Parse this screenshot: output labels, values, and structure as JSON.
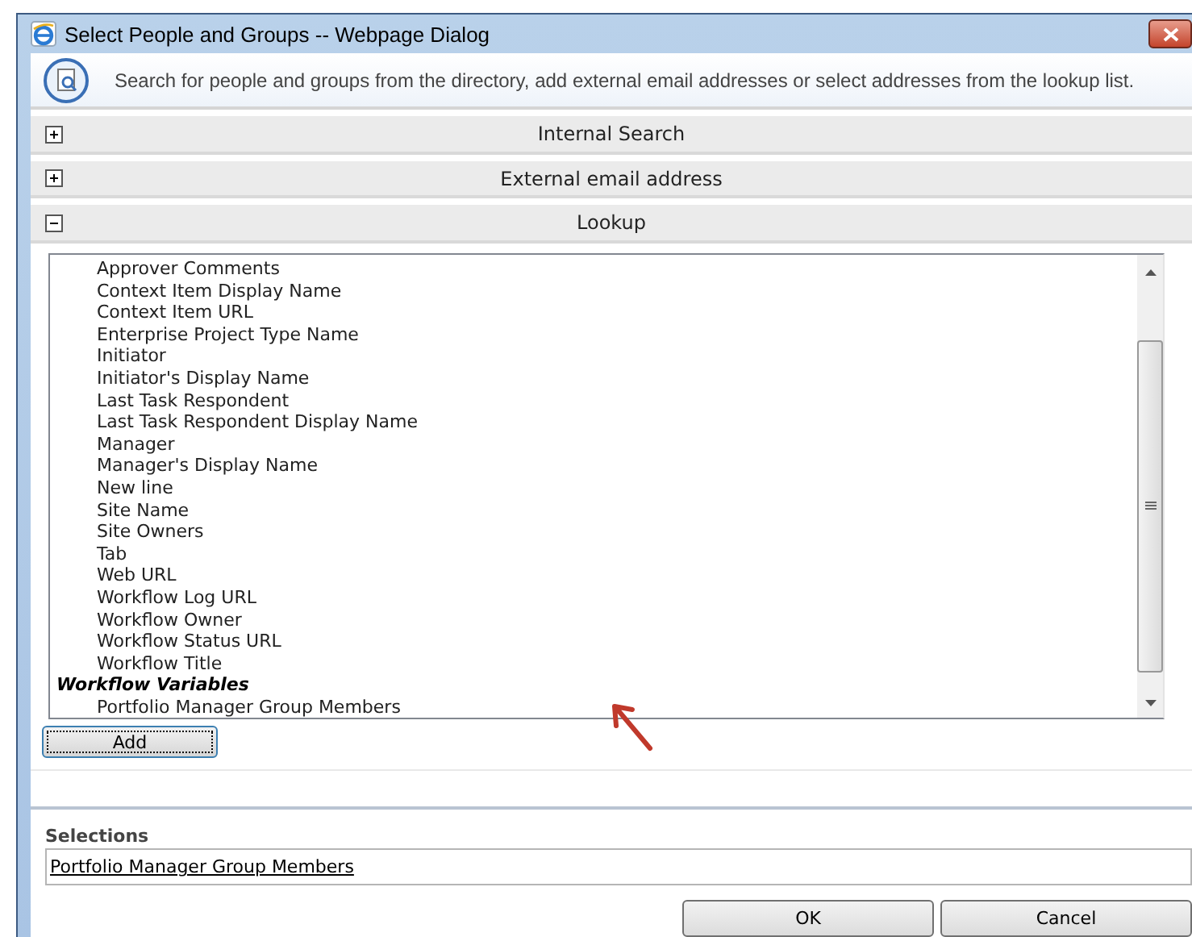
{
  "window": {
    "title": "Select People and Groups -- Webpage Dialog"
  },
  "header": {
    "description": "Search for people and groups from the directory, add external email addresses or select addresses from the lookup list."
  },
  "sections": [
    {
      "label": "Internal Search",
      "expanded": false
    },
    {
      "label": "External email address",
      "expanded": false
    },
    {
      "label": "Lookup",
      "expanded": true
    }
  ],
  "lookup": {
    "items": [
      {
        "kind": "item",
        "label": "Approver Comments"
      },
      {
        "kind": "item",
        "label": "Context Item Display Name"
      },
      {
        "kind": "item",
        "label": "Context Item URL"
      },
      {
        "kind": "item",
        "label": "Enterprise Project Type Name"
      },
      {
        "kind": "item",
        "label": "Initiator"
      },
      {
        "kind": "item",
        "label": "Initiator's Display Name"
      },
      {
        "kind": "item",
        "label": "Last Task Respondent"
      },
      {
        "kind": "item",
        "label": "Last Task Respondent Display Name"
      },
      {
        "kind": "item",
        "label": "Manager"
      },
      {
        "kind": "item",
        "label": "Manager's Display Name"
      },
      {
        "kind": "item",
        "label": "New line"
      },
      {
        "kind": "item",
        "label": "Site Name"
      },
      {
        "kind": "item",
        "label": "Site Owners"
      },
      {
        "kind": "item",
        "label": "Tab"
      },
      {
        "kind": "item",
        "label": "Web URL"
      },
      {
        "kind": "item",
        "label": "Workflow Log URL"
      },
      {
        "kind": "item",
        "label": "Workflow Owner"
      },
      {
        "kind": "item",
        "label": "Workflow Status URL"
      },
      {
        "kind": "item",
        "label": "Workflow Title"
      },
      {
        "kind": "group",
        "label": "Workflow Variables"
      },
      {
        "kind": "item",
        "label": "Portfolio Manager Group Members"
      }
    ],
    "add_button": "Add"
  },
  "selections": {
    "label": "Selections",
    "value": "Portfolio Manager Group Members"
  },
  "buttons": [
    "OK",
    "Cancel"
  ]
}
